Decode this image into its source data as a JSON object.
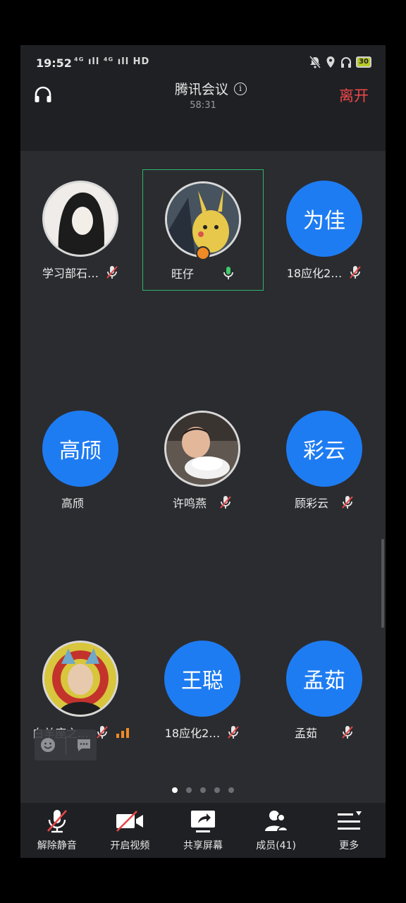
{
  "status_bar": {
    "time": "19:52",
    "signal_text": "⁴ᴳ ıll ⁴ᴳ ıll HD",
    "battery": "30"
  },
  "header": {
    "title": "腾讯会议",
    "duration": "58:31",
    "leave_label": "离开"
  },
  "participants": [
    {
      "name": "学习部石…",
      "avatar_text": "",
      "photo": true,
      "muted": true,
      "active": false
    },
    {
      "name": "旺仔",
      "avatar_text": "",
      "photo": true,
      "muted": false,
      "active": true,
      "host": true
    },
    {
      "name": "18应化2…",
      "avatar_text": "为佳",
      "photo": false,
      "muted": true,
      "active": false
    },
    {
      "name": "高颀",
      "avatar_text": "高颀",
      "photo": false,
      "muted": null,
      "active": false
    },
    {
      "name": "许鸣燕",
      "avatar_text": "",
      "photo": true,
      "muted": true,
      "active": false
    },
    {
      "name": "顾彩云",
      "avatar_text": "彩云",
      "photo": false,
      "muted": true,
      "active": false
    },
    {
      "name": "白羊座之…",
      "avatar_text": "",
      "photo": true,
      "muted": true,
      "active": false
    },
    {
      "name": "18应化2…",
      "avatar_text": "王聪",
      "photo": false,
      "muted": true,
      "active": false
    },
    {
      "name": "孟茹",
      "avatar_text": "孟茹",
      "photo": false,
      "muted": true,
      "active": false
    }
  ],
  "page_dots": {
    "count": 5,
    "current": 0
  },
  "toolbar": {
    "unmute": "解除静音",
    "video": "开启视频",
    "share": "共享屏幕",
    "members": "成员(41)",
    "more": "更多"
  },
  "colors": {
    "accent_blue": "#1e7cf2",
    "leave_red": "#f0484a",
    "active_green": "#2fb46b",
    "muted_red": "#e84545"
  }
}
